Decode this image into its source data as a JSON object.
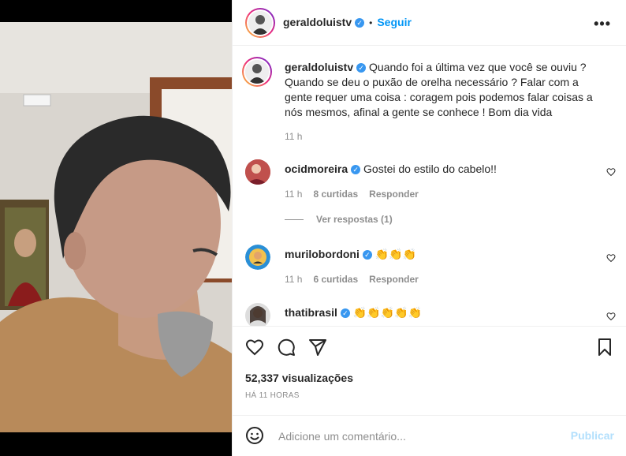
{
  "post": {
    "username": "geraldoluistv",
    "follow_label": "Seguir",
    "more_label": "•••",
    "caption": "Quando foi a última vez que você se ouviu ? Quando se deu o puxão de orelha necessário ? Falar com a gente requer uma coisa : coragem pois podemos falar coisas a nós mesmos, afinal a gente se conhece ! Bom dia vida",
    "caption_time": "11 h"
  },
  "comments": [
    {
      "username": "ocidmoreira",
      "text": "Gostei do estilo do cabelo!!",
      "time": "11 h",
      "likes": "8 curtidas",
      "reply": "Responder"
    },
    {
      "username": "murilobordoni",
      "text": "👏👏👏",
      "time": "11 h",
      "likes": "6 curtidas",
      "reply": "Responder"
    },
    {
      "username": "thatibrasil",
      "text": "👏👏👏👏👏"
    }
  ],
  "view_replies": "Ver respostas (1)",
  "stats": {
    "views": "52,337 visualizações",
    "posted": "HÁ 11 HORAS"
  },
  "add_comment": {
    "placeholder": "Adicione um comentário...",
    "publish": "Publicar"
  },
  "icons": {
    "like": "heart-icon",
    "comment": "comment-icon",
    "share": "share-icon",
    "save": "bookmark-icon",
    "emoji": "emoji-icon"
  },
  "colors": {
    "accent": "#0095f6",
    "verified": "#3897f0",
    "muted": "#8e8e8e",
    "publish_disabled": "#b2dffc"
  }
}
